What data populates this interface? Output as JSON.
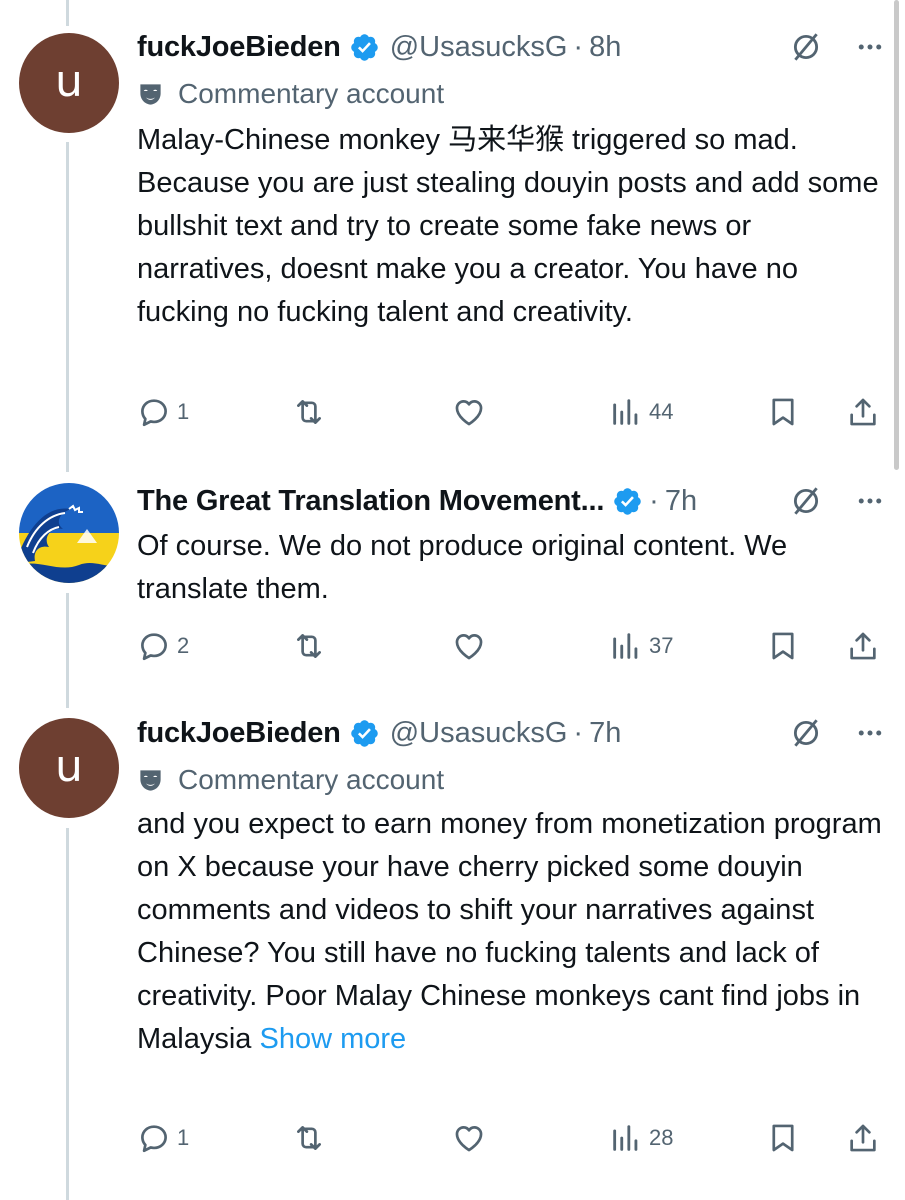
{
  "tweets": [
    {
      "avatar_letter": "u",
      "name": "fuckJoeBieden",
      "handle": "@UsasucksG",
      "separator": "·",
      "time": "8h",
      "label": "Commentary account",
      "text": "Malay-Chinese monkey 马来华猴 triggered so mad.  Because you are just stealing douyin posts and add some bullshit text and try to create some fake news or narratives, doesnt make you a creator. You have no fucking no fucking talent and creativity.",
      "replies": "1",
      "reposts": "",
      "likes": "",
      "views": "44"
    },
    {
      "name": "The Great Translation Movement...",
      "separator": "·",
      "time": "7h",
      "text": "Of course. We do not produce original content. We translate them.",
      "replies": "2",
      "reposts": "",
      "likes": "",
      "views": "37"
    },
    {
      "avatar_letter": "u",
      "name": "fuckJoeBieden",
      "handle": "@UsasucksG",
      "separator": "·",
      "time": "7h",
      "label": "Commentary account",
      "text": "and you expect to earn money from monetization program on X because your have cherry picked some douyin comments and videos to shift your narratives against Chinese? You still have no fucking talents and lack of creativity.  Poor Malay Chinese monkeys cant find jobs in Malaysia",
      "show_more": "Show more",
      "replies": "1",
      "reposts": "",
      "likes": "",
      "views": "28"
    }
  ],
  "colors": {
    "text": "#0f1419",
    "secondary": "#536471",
    "link": "#1d9bf0",
    "verified": "#1d9bf0",
    "avatar_brown": "#6e3f31",
    "thread_line": "#cfd9de"
  },
  "icons": [
    "verified-badge-icon",
    "grok-icon",
    "more-icon",
    "commentary-mask-icon",
    "reply-icon",
    "repost-icon",
    "like-icon",
    "views-icon",
    "bookmark-icon",
    "share-icon"
  ]
}
